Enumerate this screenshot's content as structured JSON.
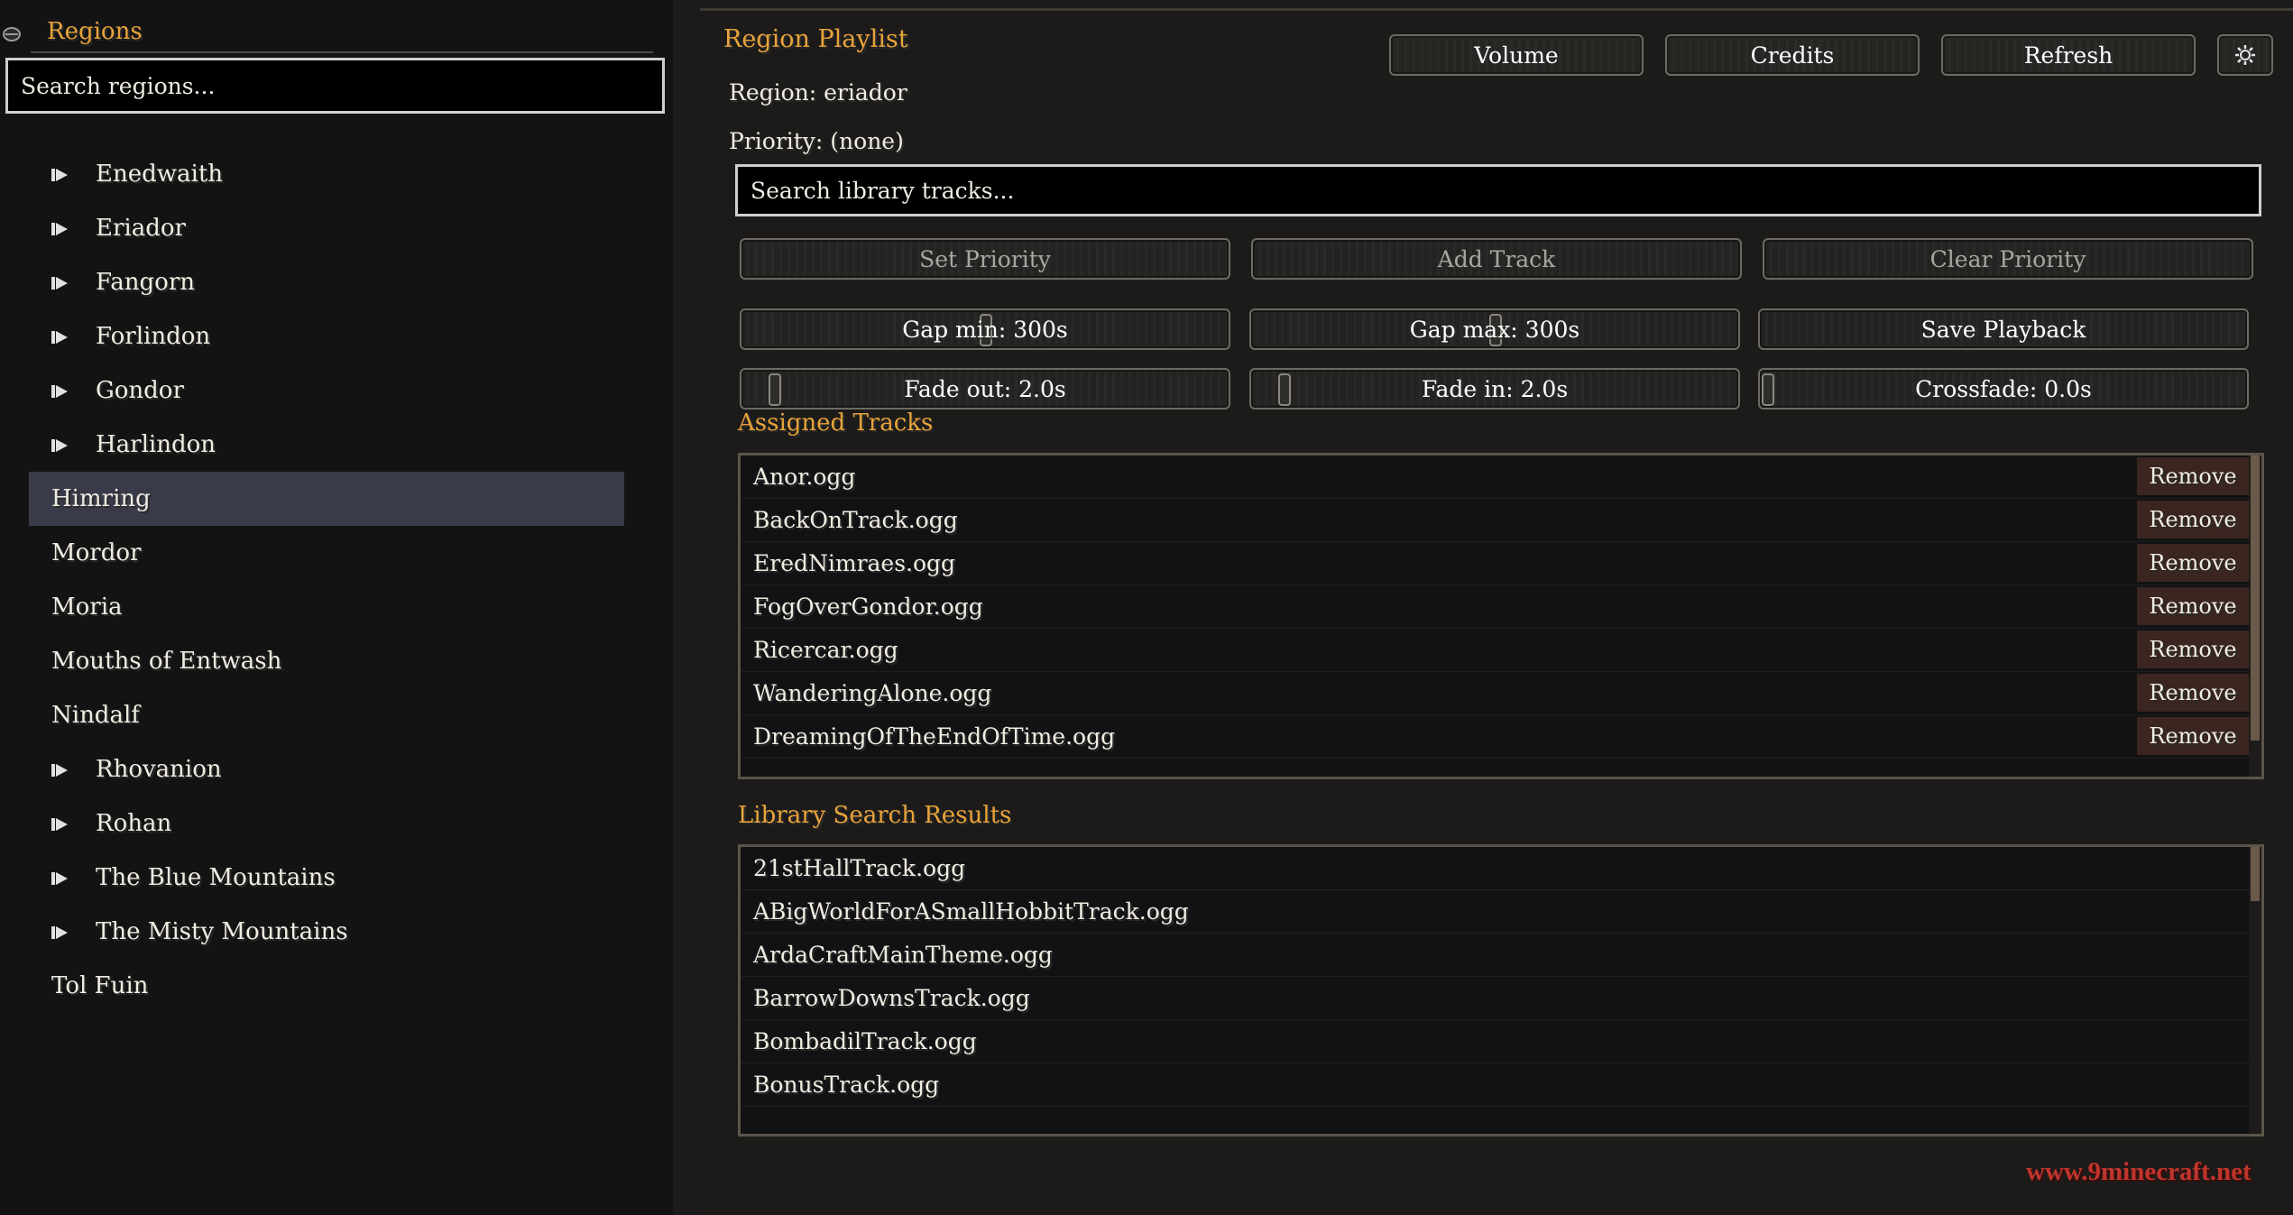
{
  "left": {
    "title": "Regions",
    "search_placeholder": "Search regions...",
    "items": [
      {
        "label": "Enedwaith",
        "expandable": true
      },
      {
        "label": "Eriador",
        "expandable": true
      },
      {
        "label": "Fangorn",
        "expandable": true
      },
      {
        "label": "Forlindon",
        "expandable": true
      },
      {
        "label": "Gondor",
        "expandable": true
      },
      {
        "label": "Harlindon",
        "expandable": true
      },
      {
        "label": "Himring",
        "expandable": false,
        "selected": true
      },
      {
        "label": "Mordor",
        "expandable": false
      },
      {
        "label": "Moria",
        "expandable": false
      },
      {
        "label": "Mouths of Entwash",
        "expandable": false
      },
      {
        "label": "Nindalf",
        "expandable": false
      },
      {
        "label": "Rhovanion",
        "expandable": true
      },
      {
        "label": "Rohan",
        "expandable": true
      },
      {
        "label": "The Blue Mountains",
        "expandable": true
      },
      {
        "label": "The Misty Mountains",
        "expandable": true
      },
      {
        "label": "Tol Fuin",
        "expandable": false
      }
    ]
  },
  "header": {
    "title": "Region Playlist",
    "region_text": "Region: eriador",
    "priority_text": "Priority: (none)",
    "buttons": {
      "volume": "Volume",
      "credits": "Credits",
      "refresh": "Refresh",
      "settings_icon": "gear-icon"
    }
  },
  "library_search_placeholder": "Search library tracks...",
  "controls": {
    "set_priority": "Set Priority",
    "add_track": "Add Track",
    "clear_priority": "Clear Priority",
    "gap_min": "Gap min: 300s",
    "gap_max": "Gap max: 300s",
    "save_playback": "Save Playback",
    "fade_out": "Fade out: 2.0s",
    "fade_in": "Fade in: 2.0s",
    "crossfade": "Crossfade: 0.0s"
  },
  "assigned": {
    "title": "Assigned Tracks",
    "remove_label": "Remove",
    "tracks": [
      "Anor.ogg",
      "BackOnTrack.ogg",
      "EredNimraes.ogg",
      "FogOverGondor.ogg",
      "Ricercar.ogg",
      "WanderingAlone.ogg",
      "DreamingOfTheEndOfTime.ogg"
    ]
  },
  "library": {
    "title": "Library Search Results",
    "tracks": [
      "21stHallTrack.ogg",
      "ABigWorldForASmallHobbitTrack.ogg",
      "ArdaCraftMainTheme.ogg",
      "BarrowDownsTrack.ogg",
      "BombadilTrack.ogg",
      "BonusTrack.ogg"
    ]
  },
  "watermark": "www.9minecraft.net",
  "colors": {
    "accent": "#e8a33a",
    "selected_row": "#3a3b4a",
    "remove_bg": "#3a2520",
    "watermark": "#c0352c"
  }
}
